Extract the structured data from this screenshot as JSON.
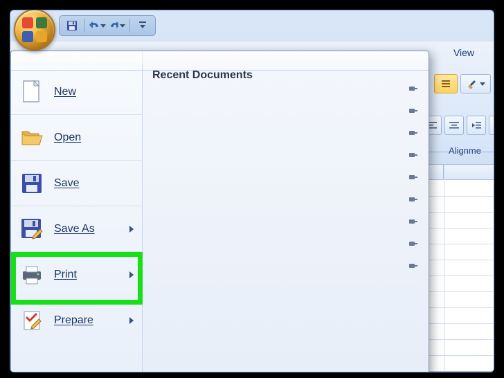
{
  "qat": {
    "save_title": "Save",
    "undo_title": "Undo",
    "redo_title": "Redo",
    "customize_title": "Customize Quick Access Toolbar"
  },
  "ribbon": {
    "tab_view": "View",
    "group_alignment": "Alignme"
  },
  "office_menu": {
    "recent_title": "Recent Documents",
    "items": {
      "new": "New",
      "open": "Open",
      "save": "Save",
      "save_as": "Save As",
      "print": "Print",
      "prepare": "Prepare"
    }
  },
  "colors": {
    "highlight": "#18e018"
  }
}
